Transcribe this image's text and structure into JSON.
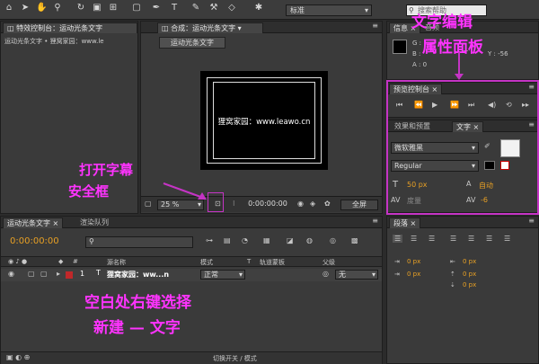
{
  "toolbar": {
    "workspace_value": "标准",
    "search_placeholder": "搜索帮助"
  },
  "effects_panel": {
    "tab_label": "特效控制台：运动光条文字",
    "breadcrumb": "运动光条文字 • 狸窝家园：www.le"
  },
  "comp_panel": {
    "tab_label": "合成：运动光条文字",
    "comp_button": "运动光条文字",
    "canvas_text": "狸窝家园：www.leawo.cn",
    "zoom": "25 %",
    "timecode": "0:00:00:00",
    "view": "全屏"
  },
  "info_panel": {
    "tab_info": "信息",
    "tab_audio": "音频",
    "g": "G :",
    "b": "B :",
    "a": "A : 0",
    "y": "Y : -56"
  },
  "preview_panel": {
    "tab_label": "预览控制台"
  },
  "text_panel": {
    "tab_effects": "效果和预置",
    "tab_text": "文字",
    "font_family": "微软雅黑",
    "font_style": "Regular",
    "size": "50 px",
    "auto": "自动",
    "tracking": "-6",
    "kern_label": "度量"
  },
  "timeline": {
    "tab_comp": "运动光条文字",
    "tab_render": "渲染队列",
    "timecode": "0:00:00:00",
    "col_source": "源名称",
    "col_mode": "模式",
    "col_t": "T",
    "col_track": "轨道蒙板",
    "col_parent": "父级",
    "layer_index": "1",
    "layer_name": "狸窝家园：ww...n",
    "layer_mode": "正常",
    "layer_parent": "无",
    "footer": "切换开关 / 模式"
  },
  "paragraph_panel": {
    "tab_label": "段落",
    "v1": "0 px",
    "v2": "0 px",
    "v3": "0 px",
    "v4": "0 px",
    "v5": "0 px"
  },
  "annotations": {
    "text_edit_1": "文字编辑",
    "text_edit_2": "属性面板",
    "safe_1": "打开字幕",
    "safe_2": "安全框",
    "right_click_1": "空白处右键选择",
    "right_click_2": "新建 — 文字"
  },
  "colors": {
    "accent": "#ff33ff",
    "orange": "#e8a024",
    "layer_red": "#c0282a"
  }
}
